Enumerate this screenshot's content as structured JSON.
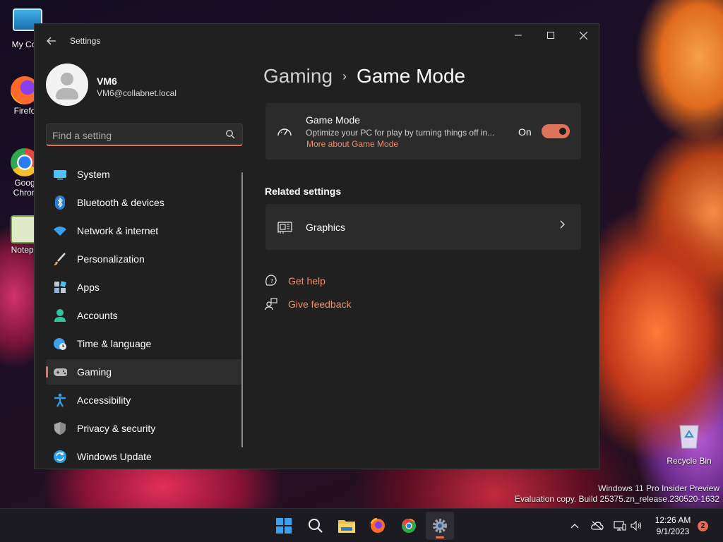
{
  "desktop": {
    "icons": [
      {
        "label": "My Com",
        "icon": "monitor-icon"
      },
      {
        "label": "Firefo",
        "icon": "firefox-icon"
      },
      {
        "label": "Goog",
        "label2": "Chron",
        "icon": "chrome-icon"
      },
      {
        "label": "Notepa",
        "icon": "notepad-icon"
      }
    ],
    "recycle_bin": "Recycle Bin",
    "watermark_line1": "Windows 11 Pro Insider Preview",
    "watermark_line2": "Evaluation copy. Build 25375.zn_release.230520-1632"
  },
  "window": {
    "app_title": "Settings",
    "user": {
      "name": "VM6",
      "email": "VM6@collabnet.local"
    },
    "search": {
      "placeholder": "Find a setting"
    },
    "nav": [
      {
        "label": "System",
        "icon": "system-icon",
        "color": "#4cc2ff"
      },
      {
        "label": "Bluetooth & devices",
        "icon": "bluetooth-icon",
        "color": "#2b7cd3"
      },
      {
        "label": "Network & internet",
        "icon": "wifi-icon",
        "color": "#3aa0f0"
      },
      {
        "label": "Personalization",
        "icon": "brush-icon",
        "color": "#e8a064"
      },
      {
        "label": "Apps",
        "icon": "apps-icon",
        "color": "#8fb3e0"
      },
      {
        "label": "Accounts",
        "icon": "accounts-icon",
        "color": "#2ec4a0"
      },
      {
        "label": "Time & language",
        "icon": "globe-clock-icon",
        "color": "#3aa0f0"
      },
      {
        "label": "Gaming",
        "icon": "gamepad-icon",
        "color": "#b8b8b8",
        "selected": true
      },
      {
        "label": "Accessibility",
        "icon": "accessibility-icon",
        "color": "#2b9fe8"
      },
      {
        "label": "Privacy & security",
        "icon": "shield-icon",
        "color": "#a8a8a8"
      },
      {
        "label": "Windows Update",
        "icon": "update-icon",
        "color": "#2b9fe8"
      }
    ],
    "breadcrumb": {
      "parent": "Gaming",
      "separator": "›",
      "current": "Game Mode"
    },
    "game_mode": {
      "title": "Game Mode",
      "description": "Optimize your PC for play by turning things off in...",
      "link": "More about Game Mode",
      "state_label": "On",
      "enabled": true
    },
    "related_settings": {
      "heading": "Related settings",
      "items": [
        {
          "label": "Graphics",
          "icon": "graphics-card-icon"
        }
      ]
    },
    "help": [
      {
        "label": "Get help",
        "icon": "help-icon"
      },
      {
        "label": "Give feedback",
        "icon": "feedback-icon"
      }
    ],
    "accent": "#e0745a"
  },
  "taskbar": {
    "apps": [
      "start-icon",
      "search-icon",
      "file-explorer-icon",
      "firefox-icon",
      "chrome-icon",
      "settings-icon"
    ],
    "clock_time": "12:26 AM",
    "clock_date": "9/1/2023",
    "notification_count": "2"
  }
}
